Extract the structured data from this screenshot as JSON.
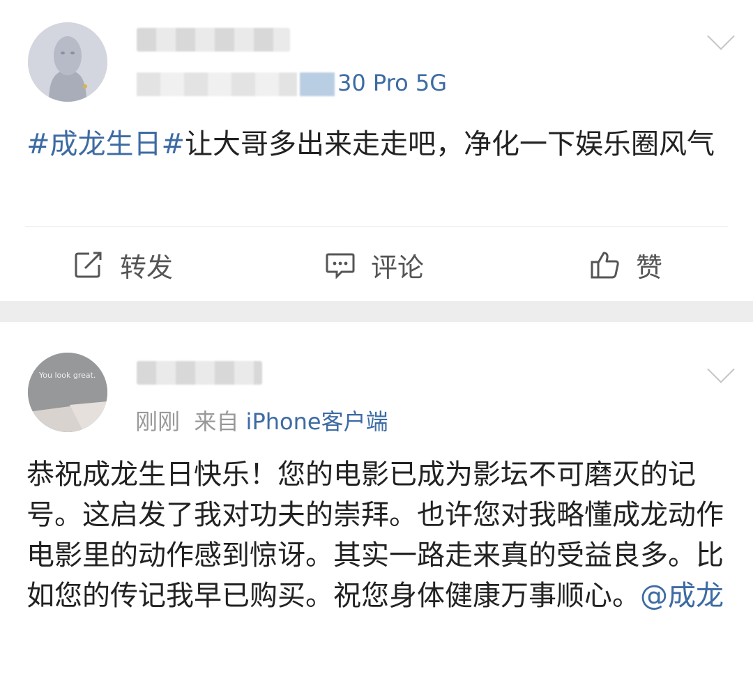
{
  "posts": [
    {
      "meta": "30 Pro 5G",
      "text_tag": "#成龙生日#",
      "text_body": "让大哥多出来走走吧，净化一下娱乐圈风气"
    },
    {
      "meta_time": "刚刚",
      "meta_from": "来自",
      "meta_source": "iPhone客户端",
      "avatar_text": "You look great.",
      "text_body": "恭祝成龙生日快乐！您的电影已成为影坛不可磨灭的记号。这启发了我对功夫的崇拜。也许您对我略懂成龙动作电影里的动作感到惊讶。其实一路走来真的受益良多。比如您的传记我早已购买。祝您身体健康万事顺心。",
      "mention": "@成龙"
    }
  ],
  "actions": {
    "repost": "转发",
    "comment": "评论",
    "like": "赞"
  },
  "colors": {
    "link": "#3d6ba3",
    "separator": "#ededed"
  }
}
